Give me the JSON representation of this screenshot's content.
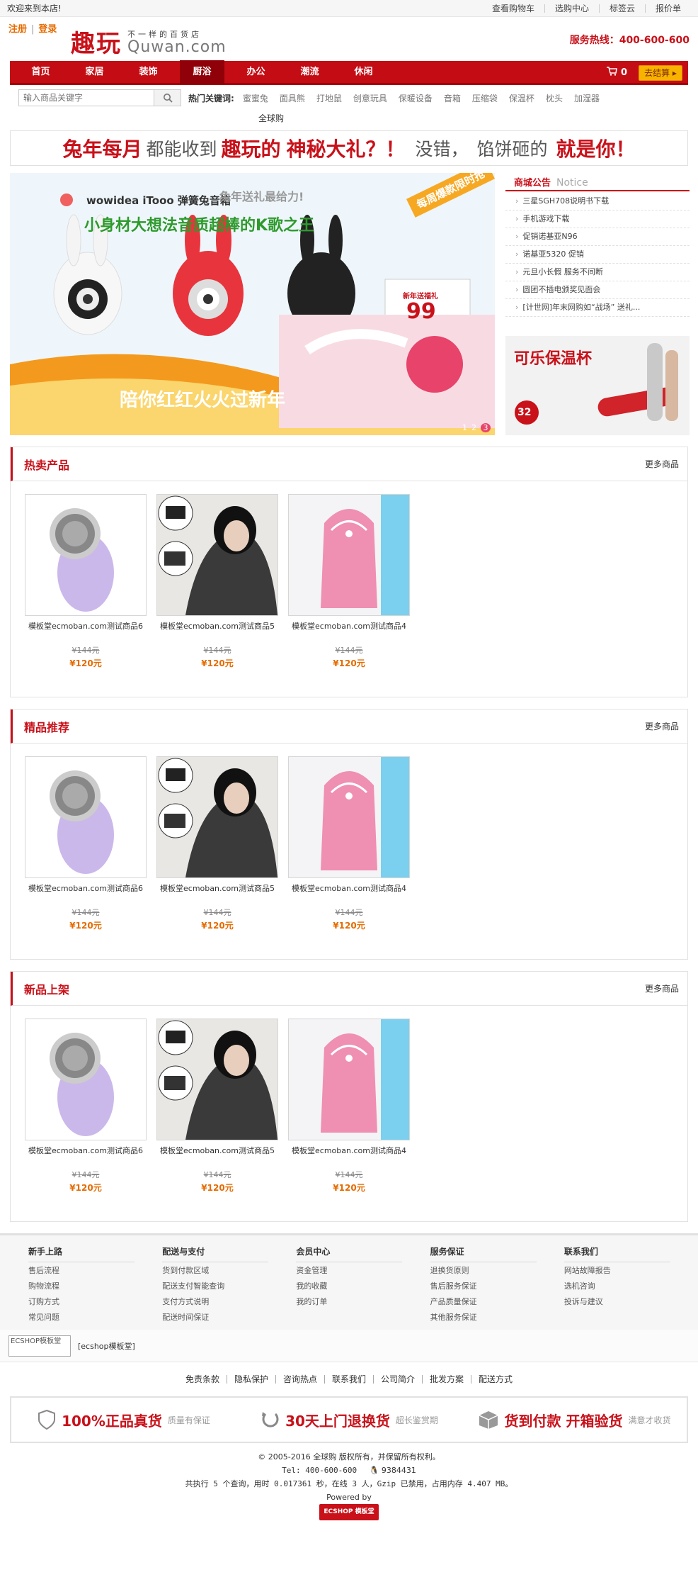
{
  "topbar": {
    "welcome": "欢迎来到本店!",
    "links": [
      "查看购物车",
      "选购中心",
      "标签云",
      "报价单"
    ]
  },
  "header": {
    "register": "注册",
    "login": "登录",
    "logo_cn": "趣玩",
    "logo_slogan": "不一样的百货店",
    "logo_en": "Quwan.com",
    "hotline": "服务热线：400-600-600"
  },
  "nav": {
    "items": [
      "首页",
      "家居",
      "装饰",
      "厨浴",
      "办公",
      "潮流",
      "休闲"
    ],
    "active_index": 3,
    "cart_count": "0",
    "checkout": "去结算"
  },
  "search": {
    "placeholder": "输入商品关键字",
    "hot_label": "热门关键词:",
    "keywords": [
      "蜜蜜兔",
      "面具熊",
      "打地鼠",
      "创意玩具",
      "保暖设备",
      "音箱",
      "压缩袋",
      "保温杯",
      "枕头",
      "加湿器"
    ],
    "extra": "全球购"
  },
  "banner": {
    "part1": "兔年每月",
    "part2": "都能收到",
    "part3": "趣玩的",
    "part4": "神秘大礼？！",
    "part5": "没错，",
    "part6": "馅饼砸的",
    "part7": "就是你！"
  },
  "slider": {
    "brand": "wowidea iTooo 弹簧兔音箱",
    "headline": "小身材大想法音质超棒的K歌之王",
    "tag": "每周爆款限时抢",
    "gift": "兔年送礼最给力!",
    "bottom": "陪你红红火火过新年",
    "calendar_title": "新年送福礼",
    "calendar_num": "99",
    "pages": [
      "1",
      "2",
      "3"
    ],
    "active_page": 2
  },
  "notice": {
    "title": "商城公告",
    "title_en": "Notice",
    "items": [
      "三星SGH708说明书下载",
      "手机游戏下载",
      "促销诺基亚N96",
      "诺基亚5320 促销",
      "元旦小长假 服务不间断",
      "圆团不插电颁奖见面会",
      "[计世网]年末网购如“战场” 送礼..."
    ]
  },
  "ad": {
    "title": "可乐保温杯",
    "price": "32"
  },
  "sections": [
    {
      "title": "热卖产品",
      "more": "更多商品",
      "goods": [
        {
          "name": "模板堂ecmoban.com测试商品6",
          "old": "¥144元",
          "price": "¥120元"
        },
        {
          "name": "模板堂ecmoban.com测试商品5",
          "old": "¥144元",
          "price": "¥120元"
        },
        {
          "name": "模板堂ecmoban.com测试商品4",
          "old": "¥144元",
          "price": "¥120元"
        }
      ]
    },
    {
      "title": "精品推荐",
      "more": "更多商品",
      "goods": [
        {
          "name": "模板堂ecmoban.com测试商品6",
          "old": "¥144元",
          "price": "¥120元"
        },
        {
          "name": "模板堂ecmoban.com测试商品5",
          "old": "¥144元",
          "price": "¥120元"
        },
        {
          "name": "模板堂ecmoban.com测试商品4",
          "old": "¥144元",
          "price": "¥120元"
        }
      ]
    },
    {
      "title": "新品上架",
      "more": "更多商品",
      "goods": [
        {
          "name": "模板堂ecmoban.com测试商品6",
          "old": "¥144元",
          "price": "¥120元"
        },
        {
          "name": "模板堂ecmoban.com测试商品5",
          "old": "¥144元",
          "price": "¥120元"
        },
        {
          "name": "模板堂ecmoban.com测试商品4",
          "old": "¥144元",
          "price": "¥120元"
        }
      ]
    }
  ],
  "help": [
    {
      "title": "新手上路",
      "items": [
        "售后流程",
        "购物流程",
        "订购方式",
        "常见问题"
      ]
    },
    {
      "title": "配送与支付",
      "items": [
        "货到付款区域",
        "配送支付智能查询",
        "支付方式说明",
        "配送时间保证"
      ]
    },
    {
      "title": "会员中心",
      "items": [
        "资金管理",
        "我的收藏",
        "我的订单"
      ]
    },
    {
      "title": "服务保证",
      "items": [
        "退换货原则",
        "售后服务保证",
        "产品质量保证",
        "其他服务保证"
      ]
    },
    {
      "title": "联系我们",
      "items": [
        "网站故障报告",
        "选机咨询",
        "投诉与建议"
      ]
    }
  ],
  "friend": {
    "img_alt": "ECSHOP模板堂",
    "text": "[ecshop模板堂]"
  },
  "footer_links": [
    "免责条款",
    "隐私保护",
    "咨询热点",
    "联系我们",
    "公司简介",
    "批发方案",
    "配送方式"
  ],
  "promise": [
    {
      "big": "100%正品真货",
      "small": "质量有保证"
    },
    {
      "big": "30天上门退换货",
      "small": "超长鉴赏期"
    },
    {
      "big": "货到付款 开箱验货",
      "small": "满意才收货"
    }
  ],
  "copyright": {
    "line1": "© 2005-2016 全球购 版权所有，并保留所有权利。",
    "tel": "Tel: 400-600-600",
    "qq": "9384431",
    "stats": "共执行 5 个查询，用时 0.017361 秒，在线 3 人，Gzip 已禁用，占用内存 4.407 MB。",
    "powered": "Powered by",
    "badge_left": "ECSHOP",
    "badge_right": "模板堂"
  },
  "colors": {
    "brand_red": "#c9111a",
    "orange": "#e56b00"
  }
}
